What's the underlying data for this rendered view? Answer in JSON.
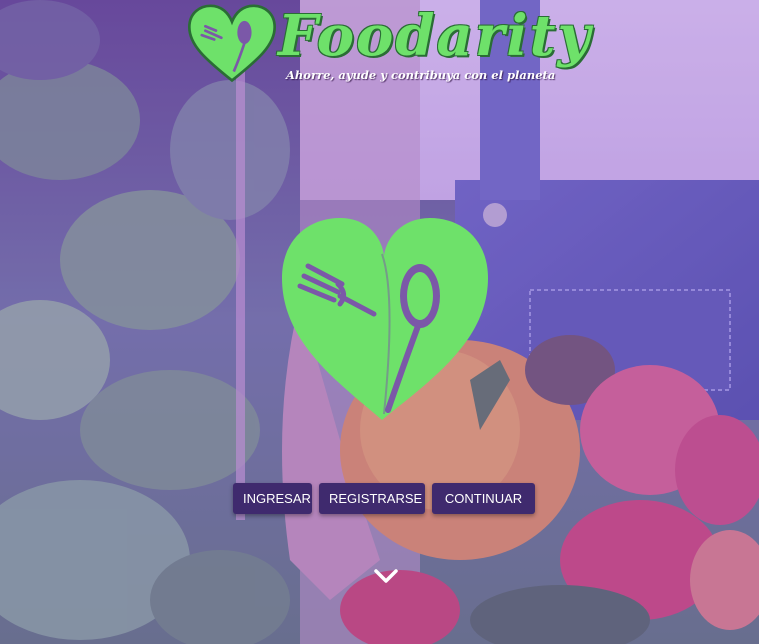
{
  "brand": {
    "name": "Foodarity",
    "tagline": "Ahorre, ayude y contribuya con el planeta"
  },
  "actions": {
    "login_label": "INGRESAR",
    "register_label": "REGISTRARSE",
    "continue_label": "CONTINUAR"
  },
  "icons": {
    "logo": "heart-fork-spoon-icon",
    "scroll": "chevron-down-icon"
  },
  "colors": {
    "brand_green": "#6ee16a",
    "button_bg": "#3f2a6e",
    "overlay": "#8046c8"
  }
}
